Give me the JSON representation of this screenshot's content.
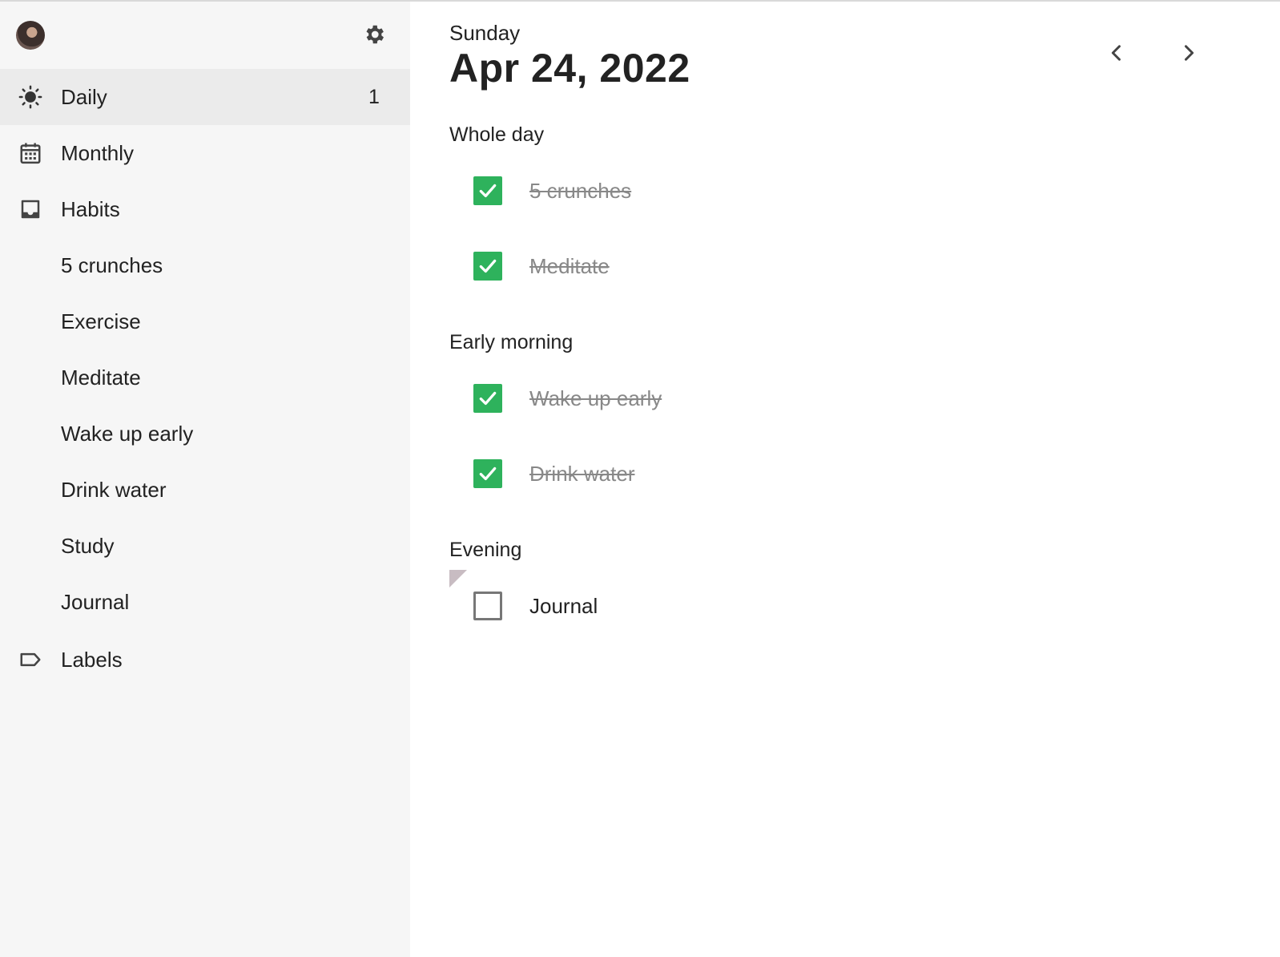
{
  "colors": {
    "accent_green": "#2eb25c",
    "sidebar_bg": "#f6f6f6",
    "active_bg": "#ebebeb"
  },
  "sidebar": {
    "avatar_icon": "user-avatar",
    "settings_icon": "gear-icon",
    "nav": [
      {
        "label": "Daily",
        "icon": "sun-icon",
        "badge": "1",
        "active": true
      },
      {
        "label": "Monthly",
        "icon": "calendar-icon"
      },
      {
        "label": "Habits",
        "icon": "inbox-icon"
      }
    ],
    "habits": [
      "5 crunches",
      "Exercise",
      "Meditate",
      "Wake up early",
      "Drink water",
      "Study",
      "Journal"
    ],
    "labels_item": {
      "label": "Labels",
      "icon": "label-icon"
    }
  },
  "header": {
    "weekday": "Sunday",
    "date": "Apr 24, 2022",
    "prev_icon": "chevron-left-icon",
    "next_icon": "chevron-right-icon"
  },
  "sections": [
    {
      "title": "Whole day",
      "tasks": [
        {
          "label": "5 crunches",
          "done": true
        },
        {
          "label": "Meditate",
          "done": true
        }
      ]
    },
    {
      "title": "Early morning",
      "tasks": [
        {
          "label": "Wake up early",
          "done": true
        },
        {
          "label": "Drink water",
          "done": true
        }
      ]
    },
    {
      "title": "Evening",
      "tasks": [
        {
          "label": "Journal",
          "done": false
        }
      ]
    }
  ]
}
